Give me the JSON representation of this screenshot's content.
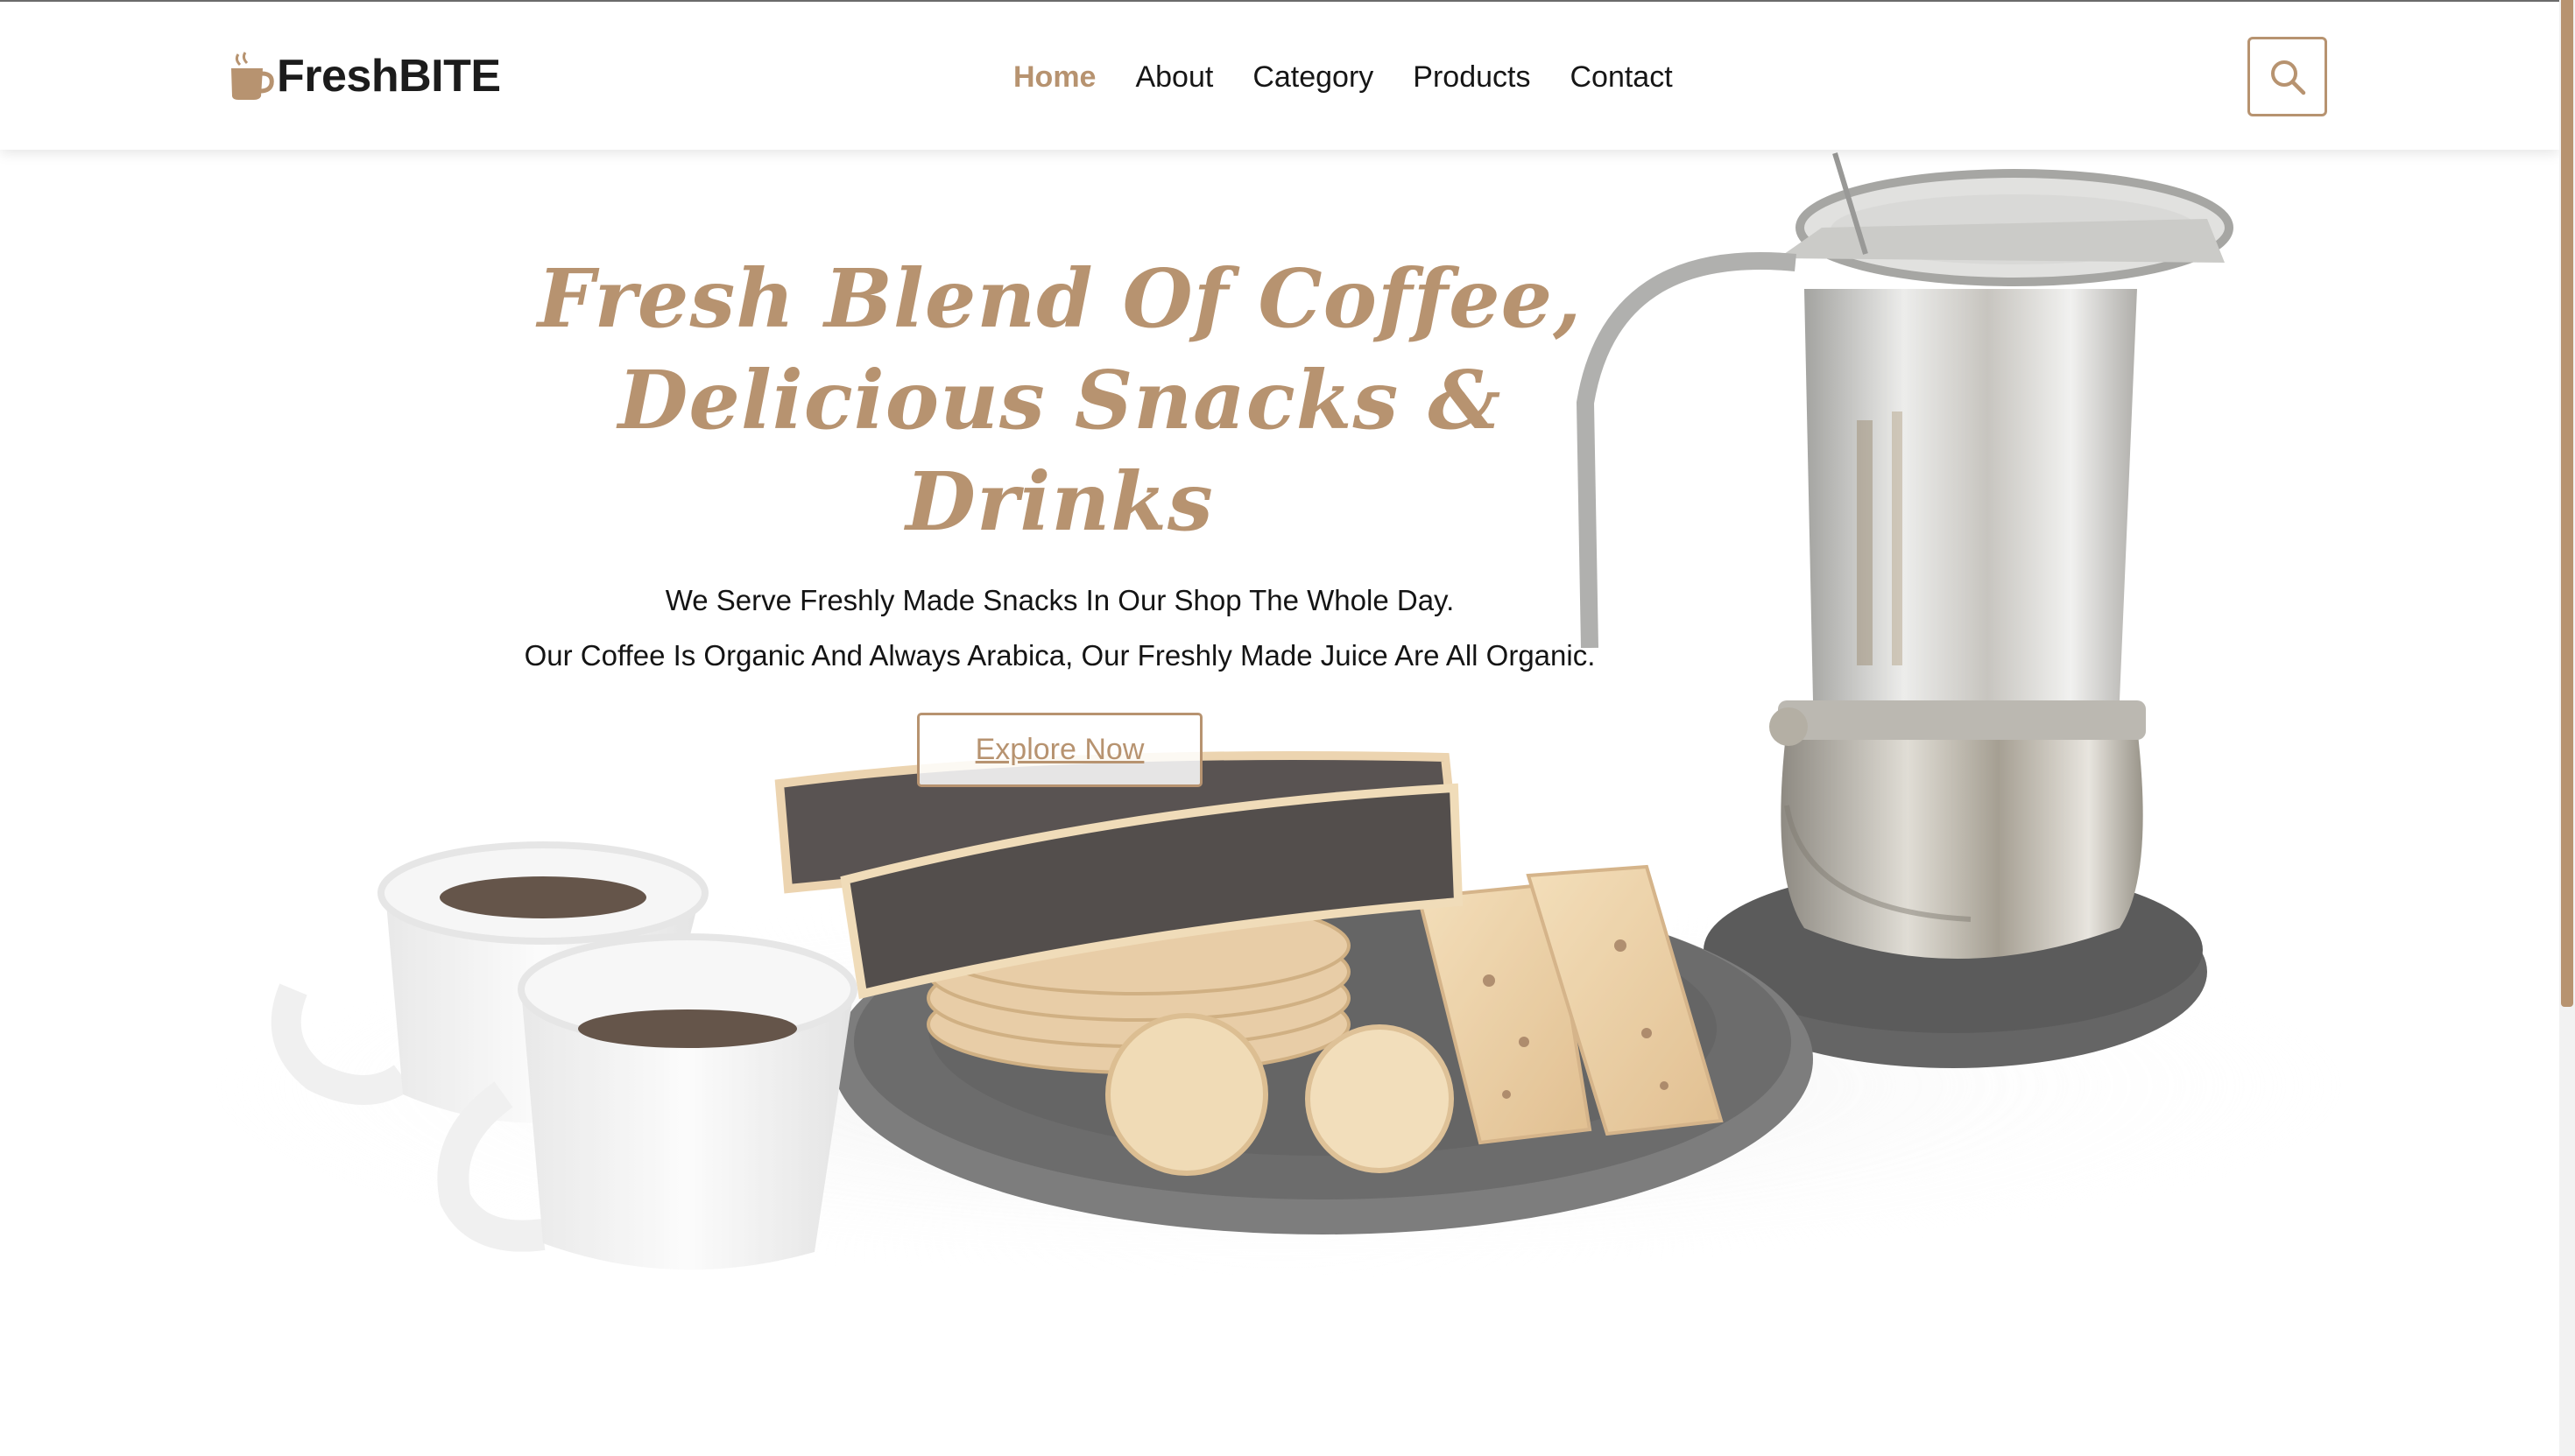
{
  "brand": {
    "name": "FreshBITE",
    "logo_icon": "coffee-cup-icon",
    "accent_color": "#b79370"
  },
  "nav": {
    "items": [
      {
        "label": "Home",
        "active": true
      },
      {
        "label": "About",
        "active": false
      },
      {
        "label": "Category",
        "active": false
      },
      {
        "label": "Products",
        "active": false
      },
      {
        "label": "Contact",
        "active": false
      }
    ],
    "search_icon": "search-icon"
  },
  "hero": {
    "title_line1": "Fresh Blend Of Coffee,",
    "title_line2": "Delicious Snacks & Drinks",
    "subtitle_line1": "We Serve Freshly Made Snacks In Our Shop The Whole Day.",
    "subtitle_line2": "Our Coffee Is Organic And Always Arabica, Our Freshly Made Juice Are All Organic.",
    "cta_label": "Explore Now"
  }
}
